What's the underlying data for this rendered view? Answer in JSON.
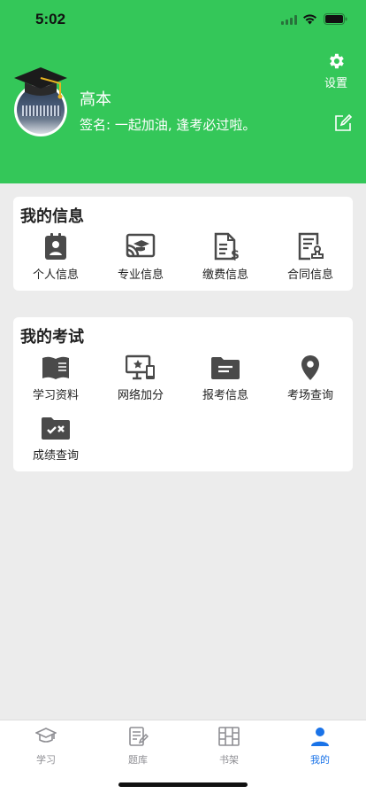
{
  "status": {
    "time": "5:02"
  },
  "profile": {
    "name": "高本",
    "signature": "签名: 一起加油, 逢考必过啦。",
    "settings_label": "设置"
  },
  "my_info": {
    "title": "我的信息",
    "items": [
      {
        "label": "个人信息",
        "icon": "contact-card-icon"
      },
      {
        "label": "专业信息",
        "icon": "major-cast-icon"
      },
      {
        "label": "缴费信息",
        "icon": "invoice-dollar-icon"
      },
      {
        "label": "合同信息",
        "icon": "contract-stamp-icon"
      }
    ]
  },
  "my_exam": {
    "title": "我的考试",
    "items": [
      {
        "label": "学习资料",
        "icon": "book-icon"
      },
      {
        "label": "网络加分",
        "icon": "online-devices-icon"
      },
      {
        "label": "报考信息",
        "icon": "folder-icon"
      },
      {
        "label": "考场查询",
        "icon": "location-pin-icon"
      },
      {
        "label": "成绩查询",
        "icon": "score-folder-icon"
      }
    ]
  },
  "tabbar": {
    "tabs": [
      {
        "label": "学习",
        "icon": "graduation-cap-icon"
      },
      {
        "label": "题库",
        "icon": "question-bank-icon"
      },
      {
        "label": "书架",
        "icon": "bookshelf-icon"
      },
      {
        "label": "我的",
        "icon": "user-icon",
        "active": true
      }
    ]
  },
  "colors": {
    "header": "#34c759",
    "active_tab": "#1a73e8",
    "icon": "#4a4a4a"
  }
}
